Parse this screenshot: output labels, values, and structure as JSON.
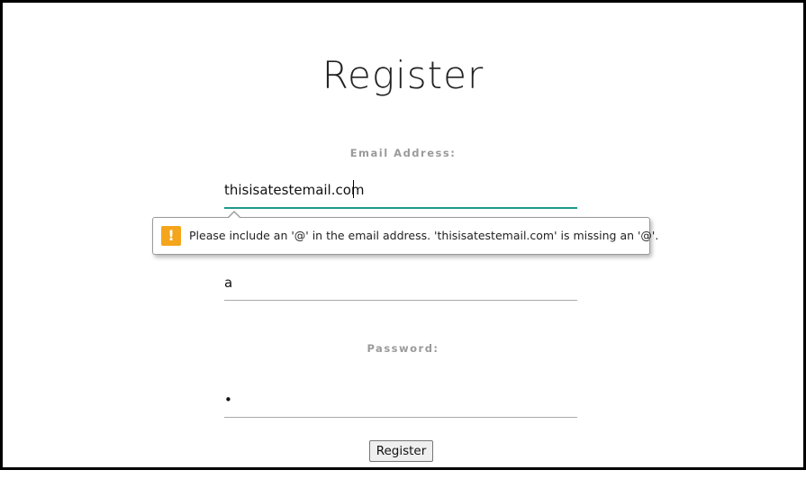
{
  "page": {
    "title": "Register"
  },
  "form": {
    "email": {
      "label": "Email Address:",
      "value": "thisisatestemail.com"
    },
    "name": {
      "value": "a"
    },
    "password": {
      "label": "Password:",
      "value": "•"
    },
    "submit_label": "Register"
  },
  "validation_tooltip": {
    "icon": "warning-icon",
    "icon_glyph": "!",
    "message": "Please include an '@' in the email address. 'thisisatestemail.com' is missing an '@'."
  },
  "colors": {
    "accent_focus": "#1e9a8e",
    "warning": "#f4a51c"
  }
}
